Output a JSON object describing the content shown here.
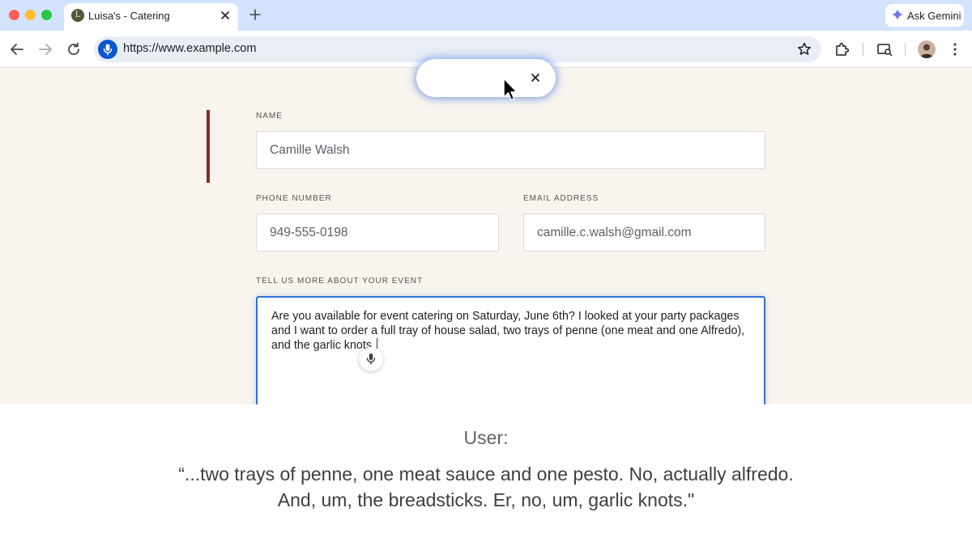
{
  "browser": {
    "tab": {
      "favicon_letter": "L",
      "title": "Luisa's - Catering"
    },
    "ask_gemini_label": "Ask Gemini",
    "url": "https://www.example.com"
  },
  "form": {
    "name_label": "NAME",
    "name_value": "Camille Walsh",
    "phone_label": "PHONE NUMBER",
    "phone_value": "949-555-0198",
    "email_label": "EMAIL ADDRESS",
    "email_value": "camille.c.walsh@gmail.com",
    "event_label": "TELL US MORE ABOUT YOUR EVENT",
    "event_value": "Are you available for event catering on Saturday, June 6th? I looked at your party packages and I want to order a full tray of house salad, two trays of penne (one meat and one Alfredo), and the garlic knots."
  },
  "caption": {
    "speaker": "User:",
    "line1": "“...two trays of penne, one meat sauce and one pesto. No, actually alfredo.",
    "line2": "And, um, the breadsticks. Er, no, um, garlic knots.\""
  },
  "colors": {
    "tabbar": "#d3e3fd",
    "page_bg": "#f9f5ee",
    "accent_bar": "#8b2a20",
    "focus_border": "#2f6fd6",
    "mic_blue": "#0b57d0"
  }
}
